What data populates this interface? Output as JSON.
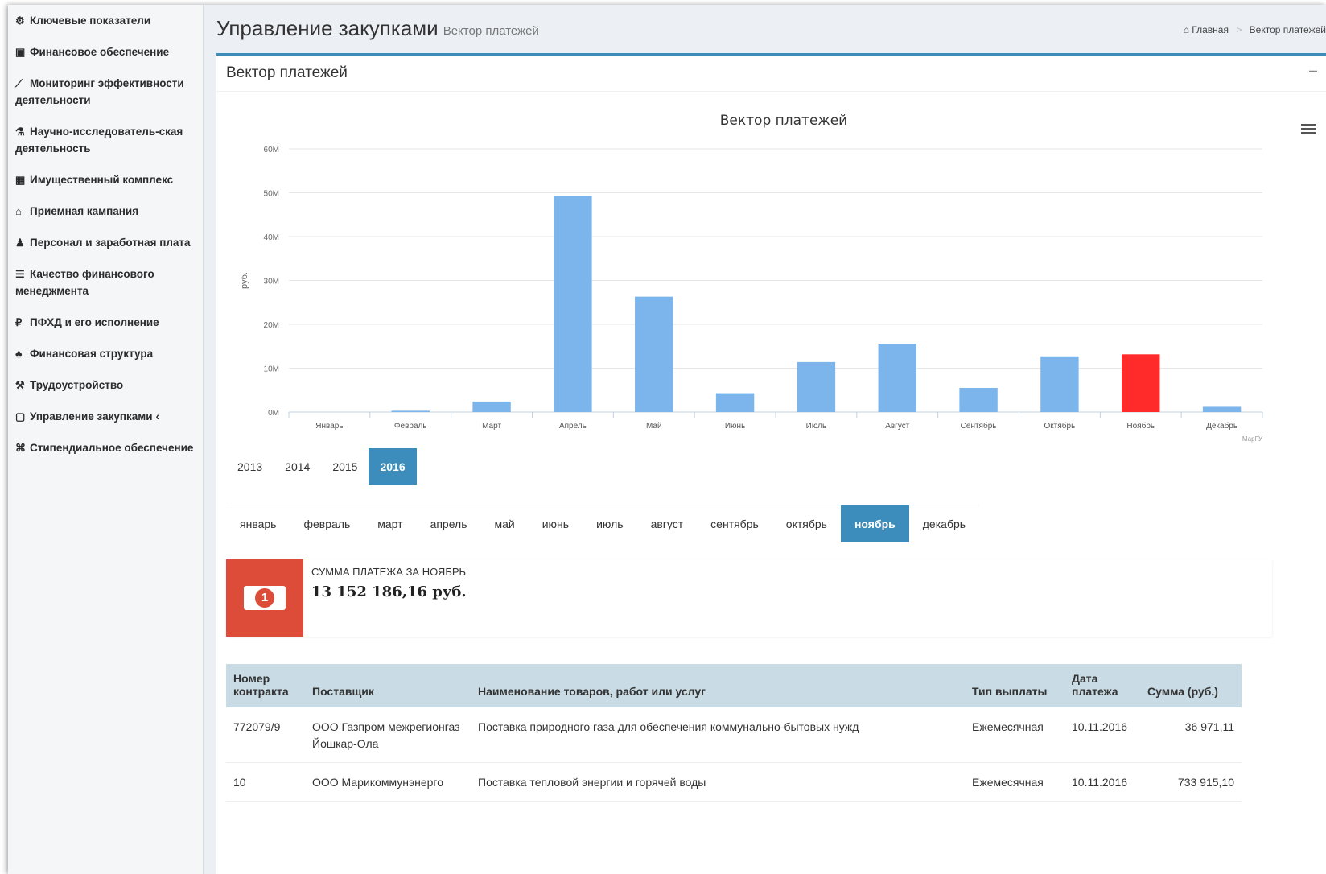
{
  "sidebar": {
    "items": [
      {
        "icon": "dashboard-icon",
        "glyph": "⚙",
        "label": "Ключевые показатели"
      },
      {
        "icon": "money-icon",
        "glyph": "▣",
        "label": "Финансовое обеспечение"
      },
      {
        "icon": "line-chart-icon",
        "glyph": "⟋",
        "label": "Мониторинг эффективности деятельности"
      },
      {
        "icon": "flask-icon",
        "glyph": "⚗",
        "label": "Научно-исследователь-ская деятельность"
      },
      {
        "icon": "building-icon",
        "glyph": "▦",
        "label": "Имущественный комплекс"
      },
      {
        "icon": "university-icon",
        "glyph": "⌂",
        "label": "Приемная кампания"
      },
      {
        "icon": "users-icon",
        "glyph": "♟",
        "label": "Персонал и заработная плата"
      },
      {
        "icon": "list-icon",
        "glyph": "☰",
        "label": "Качество финансового менеджмента"
      },
      {
        "icon": "ruble-icon",
        "glyph": "₽",
        "label": "ПФХД и его исполнение"
      },
      {
        "icon": "sitemap-icon",
        "glyph": "♣",
        "label": "Финансовая структура"
      },
      {
        "icon": "gavel-icon",
        "glyph": "⚒",
        "label": "Трудоустройство"
      },
      {
        "icon": "file-icon",
        "glyph": "▢",
        "label": "Управление закупками",
        "chevron": "‹"
      },
      {
        "icon": "graduation-cap-icon",
        "glyph": "⌘",
        "label": "Стипендиальное обеспечение"
      }
    ]
  },
  "header": {
    "title": "Управление закупками",
    "subtitle": "Вектор платежей",
    "breadcrumb_home": "Главная",
    "breadcrumb_current": "Вектор платежей"
  },
  "box": {
    "title": "Вектор платежей",
    "collapse": "–"
  },
  "chart_data": {
    "type": "bar",
    "title": "Вектор платежей",
    "ylabel": "руб.",
    "xlabel": "",
    "credits": "МарГУ",
    "ylim": [
      0,
      60000000
    ],
    "yticks": [
      0,
      10000000,
      20000000,
      30000000,
      40000000,
      50000000,
      60000000
    ],
    "ytick_labels": [
      "0M",
      "10M",
      "20M",
      "30M",
      "40M",
      "50M",
      "60M"
    ],
    "categories": [
      "Январь",
      "Февраль",
      "Март",
      "Апрель",
      "Май",
      "Июнь",
      "Июль",
      "Август",
      "Сентябрь",
      "Октябрь",
      "Ноябрь",
      "Декабрь"
    ],
    "values": [
      0,
      300000,
      2400000,
      49300000,
      26300000,
      4300000,
      11400000,
      15600000,
      5500000,
      12700000,
      13152186.16,
      1200000
    ],
    "highlight_index": 10,
    "bar_color": "#7cb5ec",
    "highlight_color": "#ff2a2a",
    "grid": true
  },
  "years": [
    "2013",
    "2014",
    "2015",
    "2016"
  ],
  "active_year": "2016",
  "months": [
    "январь",
    "февраль",
    "март",
    "апрель",
    "май",
    "июнь",
    "июль",
    "август",
    "сентябрь",
    "октябрь",
    "ноябрь",
    "декабрь"
  ],
  "active_month": "ноябрь",
  "info": {
    "label": "Сумма платежа за ноябрь",
    "value": "13 152 186,16 руб.",
    "coin": "1"
  },
  "table": {
    "headers": [
      "Номер контракта",
      "Поставщик",
      "Наименование товаров, работ или услуг",
      "Тип выплаты",
      "Дата платежа",
      "Сумма (руб.)"
    ],
    "rows": [
      [
        "772079/9",
        "ООО Газпром межрегионгаз Йошкар-Ола",
        "Поставка природного газа для обеспечения коммунально-бытовых нужд",
        "Ежемесячная",
        "10.11.2016",
        "36 971,11"
      ],
      [
        "10",
        "ООО Марикоммунэнерго",
        "Поставка тепловой энергии и горячей воды",
        "Ежемесячная",
        "10.11.2016",
        "733 915,10"
      ]
    ]
  },
  "colors": {
    "accent": "#3c8dbc",
    "info_icon_bg": "#dd4b39",
    "table_header_bg": "#c9dce6"
  }
}
